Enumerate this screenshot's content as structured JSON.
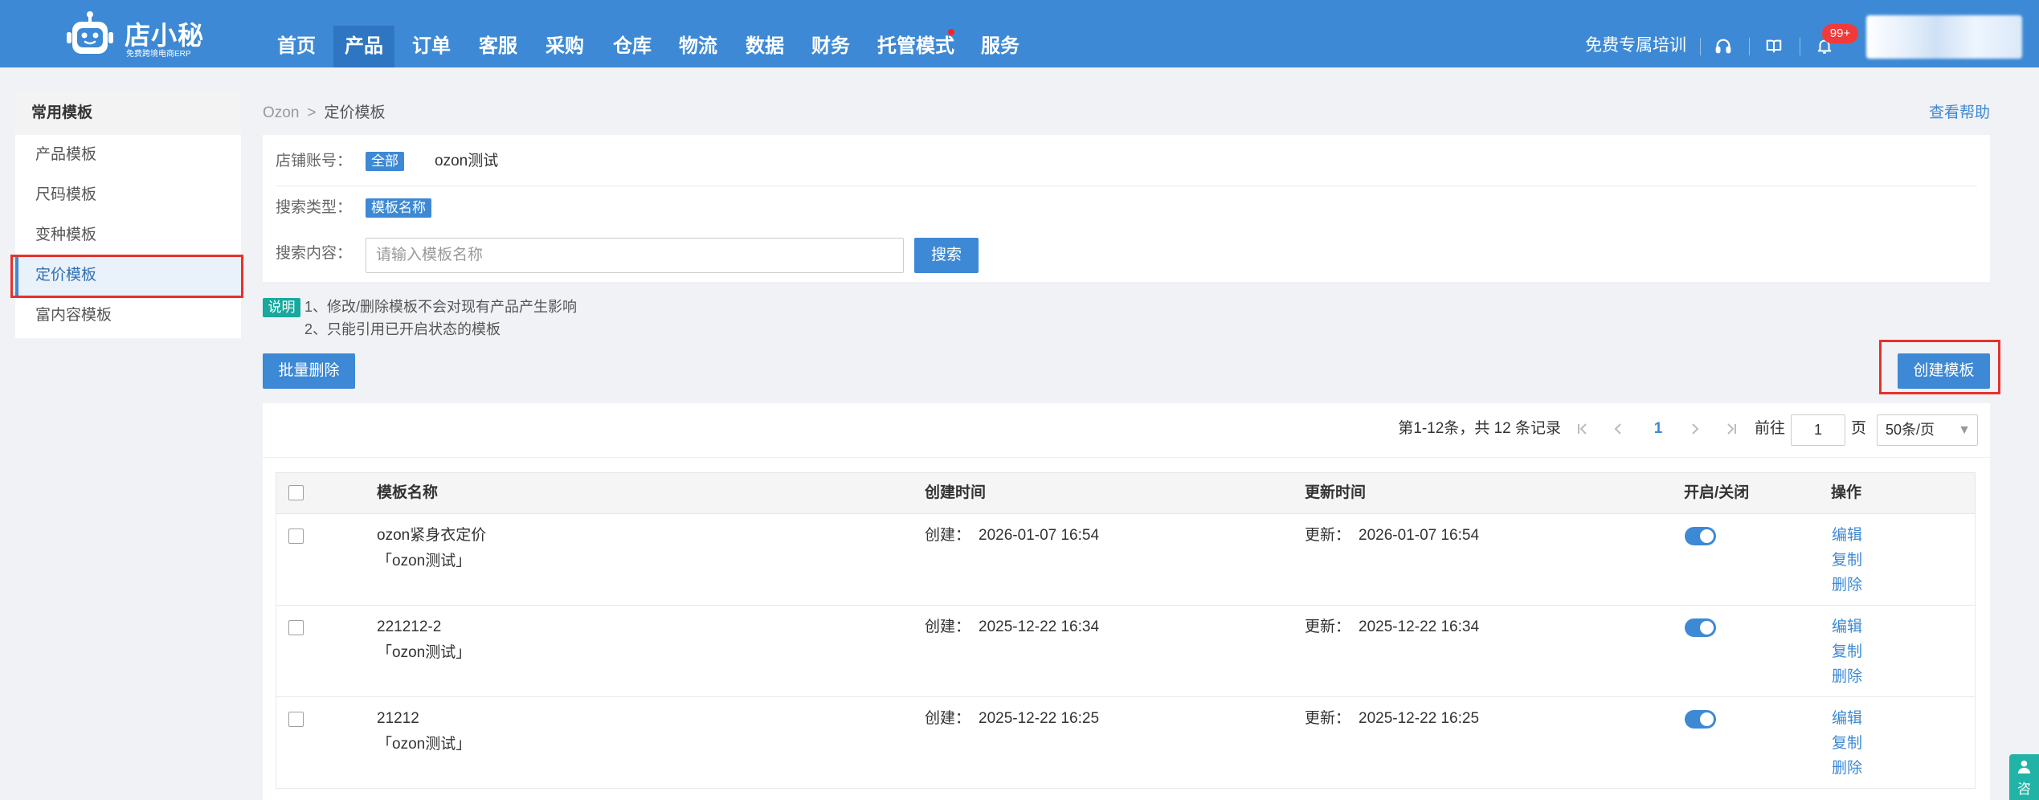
{
  "header": {
    "logo": {
      "brand": "店小秘",
      "tagline": "免费跨境电商ERP",
      "icon": "robot-logo-icon"
    },
    "nav": [
      {
        "label": "首页",
        "active": false
      },
      {
        "label": "产品",
        "active": true
      },
      {
        "label": "订单",
        "active": false
      },
      {
        "label": "客服",
        "active": false
      },
      {
        "label": "采购",
        "active": false
      },
      {
        "label": "仓库",
        "active": false
      },
      {
        "label": "物流",
        "active": false
      },
      {
        "label": "数据",
        "active": false
      },
      {
        "label": "财务",
        "active": false
      },
      {
        "label": "托管模式",
        "active": false,
        "has_dot": true
      },
      {
        "label": "服务",
        "active": false
      }
    ],
    "training_link": "免费专属培训",
    "icons": {
      "support": "headset-icon",
      "guide": "book-icon",
      "notifications": "bell-icon"
    },
    "notification_badge": "99+"
  },
  "sidebar": {
    "title": "常用模板",
    "items": [
      {
        "label": "产品模板",
        "active": false
      },
      {
        "label": "尺码模板",
        "active": false
      },
      {
        "label": "变种模板",
        "active": false
      },
      {
        "label": "定价模板",
        "active": true
      },
      {
        "label": "富内容模板",
        "active": false
      }
    ]
  },
  "breadcrumb": {
    "root": "Ozon",
    "separator": ">",
    "current": "定价模板"
  },
  "help_link": "查看帮助",
  "filters": {
    "shop": {
      "label": "店铺账号：",
      "options": [
        {
          "label": "全部",
          "selected": true
        },
        {
          "label": "ozon测试",
          "selected": false
        }
      ]
    },
    "search_type": {
      "label": "搜索类型：",
      "options": [
        {
          "label": "模板名称",
          "selected": true
        }
      ]
    },
    "search_content": {
      "label": "搜索内容：",
      "placeholder": "请输入模板名称",
      "button": "搜索"
    }
  },
  "notice": {
    "tag": "说明",
    "lines": [
      "1、修改/删除模板不会对现有产品产生影响",
      "2、只能引用已开启状态的模板"
    ]
  },
  "toolbar": {
    "bulk_delete": "批量删除",
    "create": "创建模板"
  },
  "pagination": {
    "summary": "第1-12条，共 12 条记录",
    "current_page": "1",
    "goto_label": "前往",
    "goto_value": "1",
    "page_suffix": "页",
    "page_size": "50条/页"
  },
  "table": {
    "columns": {
      "name": "模板名称",
      "created": "创建时间",
      "updated": "更新时间",
      "status": "开启/关闭",
      "actions": "操作"
    },
    "created_prefix": "创建：",
    "updated_prefix": "更新：",
    "action_labels": {
      "edit": "编辑",
      "copy": "复制",
      "delete": "删除"
    },
    "rows": [
      {
        "name": "ozon紧身衣定价",
        "shop": "「ozon测试」",
        "created": "2026-01-07 16:54",
        "updated": "2026-01-07 16:54",
        "enabled": true
      },
      {
        "name": "221212-2",
        "shop": "「ozon测试」",
        "created": "2025-12-22 16:34",
        "updated": "2025-12-22 16:34",
        "enabled": true
      },
      {
        "name": "21212",
        "shop": "「ozon测试」",
        "created": "2025-12-22 16:25",
        "updated": "2025-12-22 16:25",
        "enabled": true
      }
    ]
  },
  "consult_widget": {
    "label": "咨"
  },
  "colors": {
    "primary": "#3d89d5",
    "highlight": "#e5322d",
    "notice_tag": "#17a99e",
    "badge": "#f23a3a",
    "nav_active": "#2f76c2"
  }
}
